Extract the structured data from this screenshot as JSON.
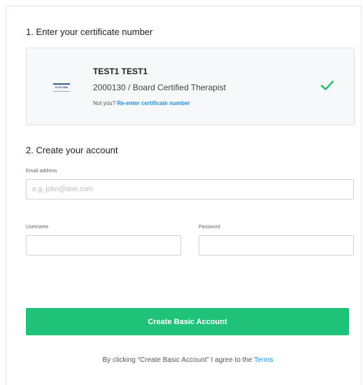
{
  "step1": {
    "title": "1. Enter your certificate number"
  },
  "certificate": {
    "logo_text": "NCBTMB",
    "name": "TEST1 TEST1",
    "detail": "2000130 / Board Certified Therapist",
    "not_you_text": "Not you?",
    "reenter_link": "Re-enter certificate number",
    "status_icon": "checkmark-icon",
    "status_color": "#2fbf71"
  },
  "step2": {
    "title": "2. Create your account",
    "email": {
      "label": "Email address",
      "placeholder": "e.g. john@doe.com",
      "value": ""
    },
    "username": {
      "label": "Username",
      "placeholder": "",
      "value": ""
    },
    "password": {
      "label": "Password",
      "placeholder": "",
      "value": ""
    }
  },
  "actions": {
    "create_button": "Create Basic Account",
    "button_color": "#20c27a"
  },
  "terms": {
    "prefix": "By clicking “Create Basic Account” I agree to the ",
    "link": "Terms",
    "link_color": "#1d8ed8"
  }
}
